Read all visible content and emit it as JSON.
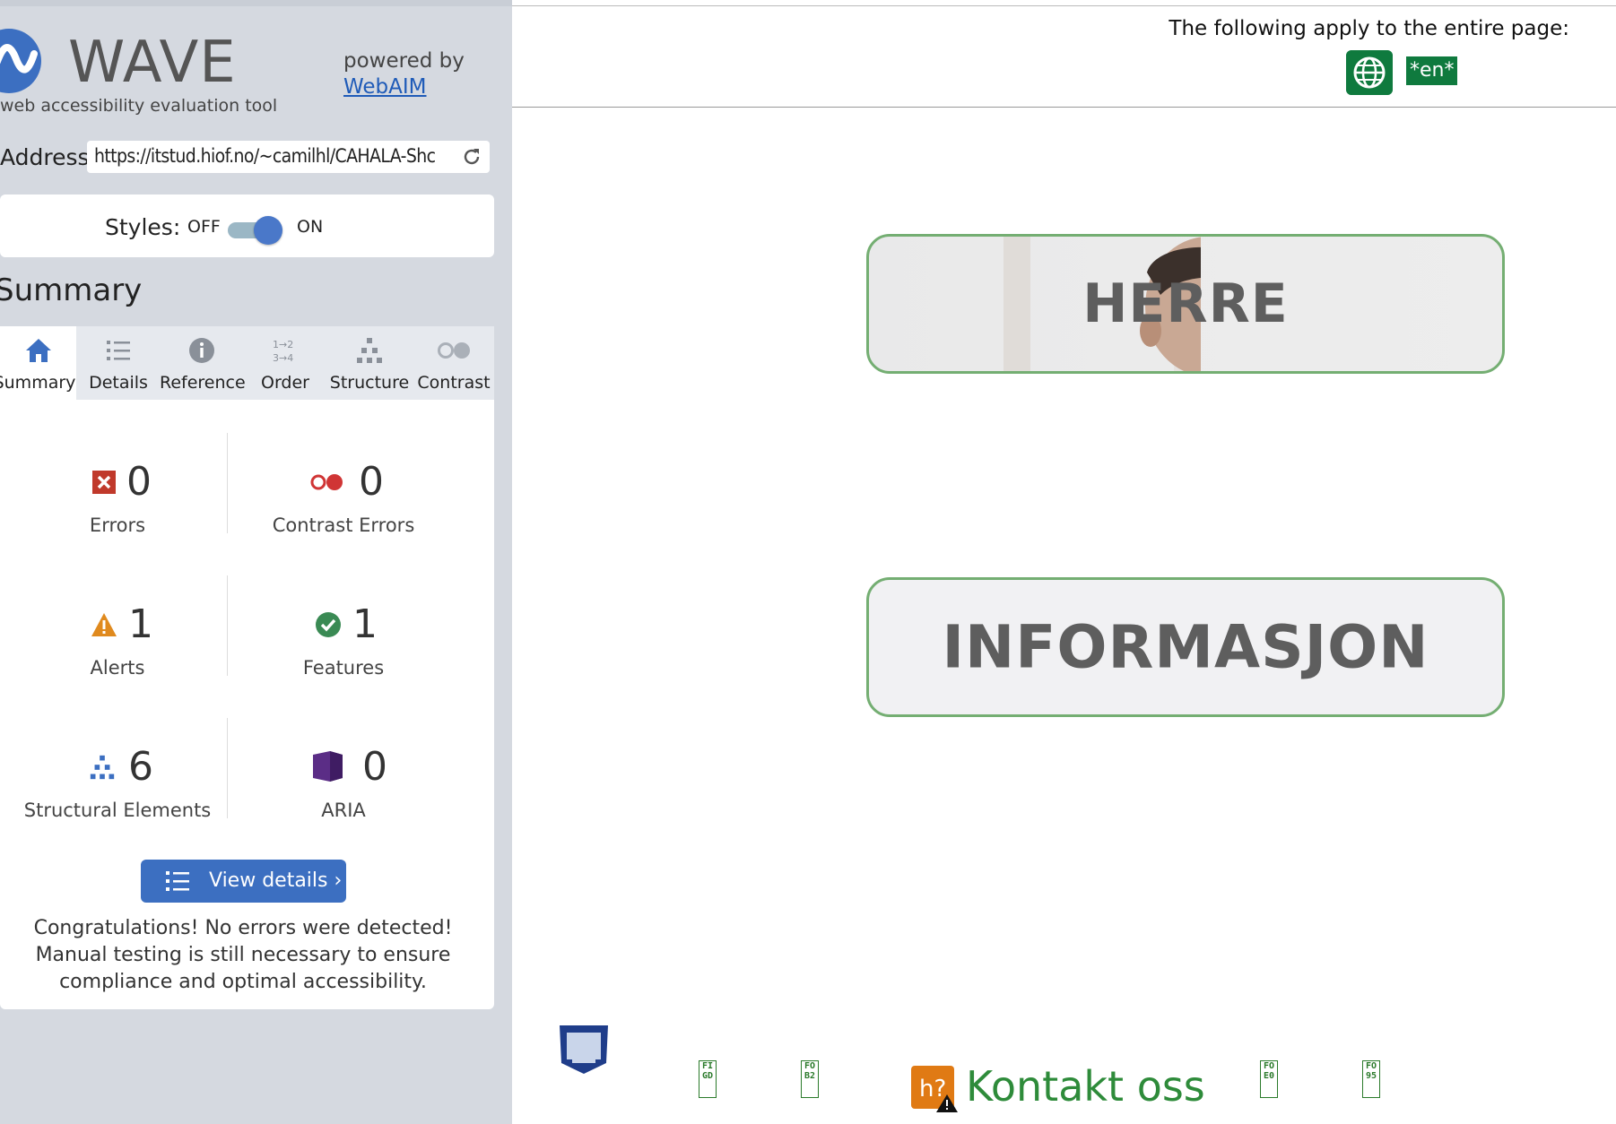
{
  "sidebar": {
    "logo_text": "WAVE",
    "tagline": "web accessibility evaluation tool",
    "powered_by": "powered by",
    "webaim_link": "WebAIM",
    "address_label": "Address:",
    "address_value": "https://itstud.hiof.no/~camilhl/CAHALA-Shc",
    "styles_label": "Styles:",
    "styles_off": "OFF",
    "styles_on": "ON",
    "styles_enabled": true,
    "summary_heading": "Summary",
    "tabs": [
      {
        "label": "Summary",
        "icon": "home-icon",
        "active": true
      },
      {
        "label": "Details",
        "icon": "list-icon",
        "active": false
      },
      {
        "label": "Reference",
        "icon": "info-icon",
        "active": false
      },
      {
        "label": "Order",
        "icon": "order-icon",
        "active": false
      },
      {
        "label": "Structure",
        "icon": "structure-icon",
        "active": false
      },
      {
        "label": "Contrast",
        "icon": "contrast-icon",
        "active": false
      }
    ],
    "stats": {
      "errors": {
        "count": "0",
        "label": "Errors",
        "icon": "error-x-icon",
        "color": "#c0392b"
      },
      "contrast_errors": {
        "count": "0",
        "label": "Contrast Errors",
        "icon": "contrast-error-icon",
        "color": "#d03535"
      },
      "alerts": {
        "count": "1",
        "label": "Alerts",
        "icon": "alert-triangle-icon",
        "color": "#e08a1e"
      },
      "features": {
        "count": "1",
        "label": "Features",
        "icon": "feature-check-icon",
        "color": "#3a8a54"
      },
      "structural": {
        "count": "6",
        "label": "Structural Elements",
        "icon": "structure-icon",
        "color": "#3c6fc1"
      },
      "aria": {
        "count": "0",
        "label": "ARIA",
        "icon": "aria-cube-icon",
        "color": "#5b2d86"
      }
    },
    "view_details": "View details ›",
    "congrats": "Congratulations! No errors were detected! Manual testing is still necessary to ensure compliance and optimal accessibility."
  },
  "page": {
    "entire_page_text": "The following apply to the entire page:",
    "lang_tag": "*en*",
    "nav_buttons": [
      {
        "label": "HERRE"
      },
      {
        "label": "INFORMASJON"
      }
    ],
    "footer": {
      "small_features": [
        "FIGD",
        "FOB2",
        "FOE0",
        "FO95"
      ],
      "kontakt": "Kontakt oss",
      "heading_icon_text": "h?"
    }
  },
  "colors": {
    "sidebar_bg": "#d5d9e0",
    "accent_blue": "#3c6fc1",
    "nav_border_green": "#74ae72",
    "wave_green": "#0f7a3e",
    "link_green": "#2e8b3a"
  }
}
